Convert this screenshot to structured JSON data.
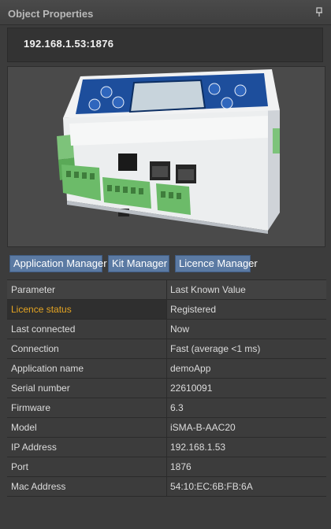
{
  "panel": {
    "title": "Object Properties",
    "pin_icon": "pin-icon"
  },
  "address": "192.168.1.53:1876",
  "device_image": {
    "alt": "iSMA-B-AAC20 controller"
  },
  "buttons": {
    "application_manager": "Application Manager",
    "kit_manager": "Kit Manager",
    "licence_manager": "Licence Manager"
  },
  "table": {
    "headers": [
      "Parameter",
      "Last Known Value"
    ],
    "rows": [
      {
        "param": "Licence status",
        "value": "Registered"
      },
      {
        "param": "Last connected",
        "value": "Now"
      },
      {
        "param": "Connection",
        "value": "Fast (average <1 ms)"
      },
      {
        "param": "Application name",
        "value": "demoApp"
      },
      {
        "param": "Serial number",
        "value": "22610091"
      },
      {
        "param": "Firmware",
        "value": "6.3"
      },
      {
        "param": "Model",
        "value": "iSMA-B-AAC20"
      },
      {
        "param": "IP Address",
        "value": "192.168.1.53"
      },
      {
        "param": "Port",
        "value": "1876"
      },
      {
        "param": "Mac Address",
        "value": "54:10:EC:6B:FB:6A"
      }
    ]
  },
  "colors": {
    "accent_orange": "#e4a422",
    "button_blue": "#5b7aa3",
    "background": "#3c3c3c"
  }
}
